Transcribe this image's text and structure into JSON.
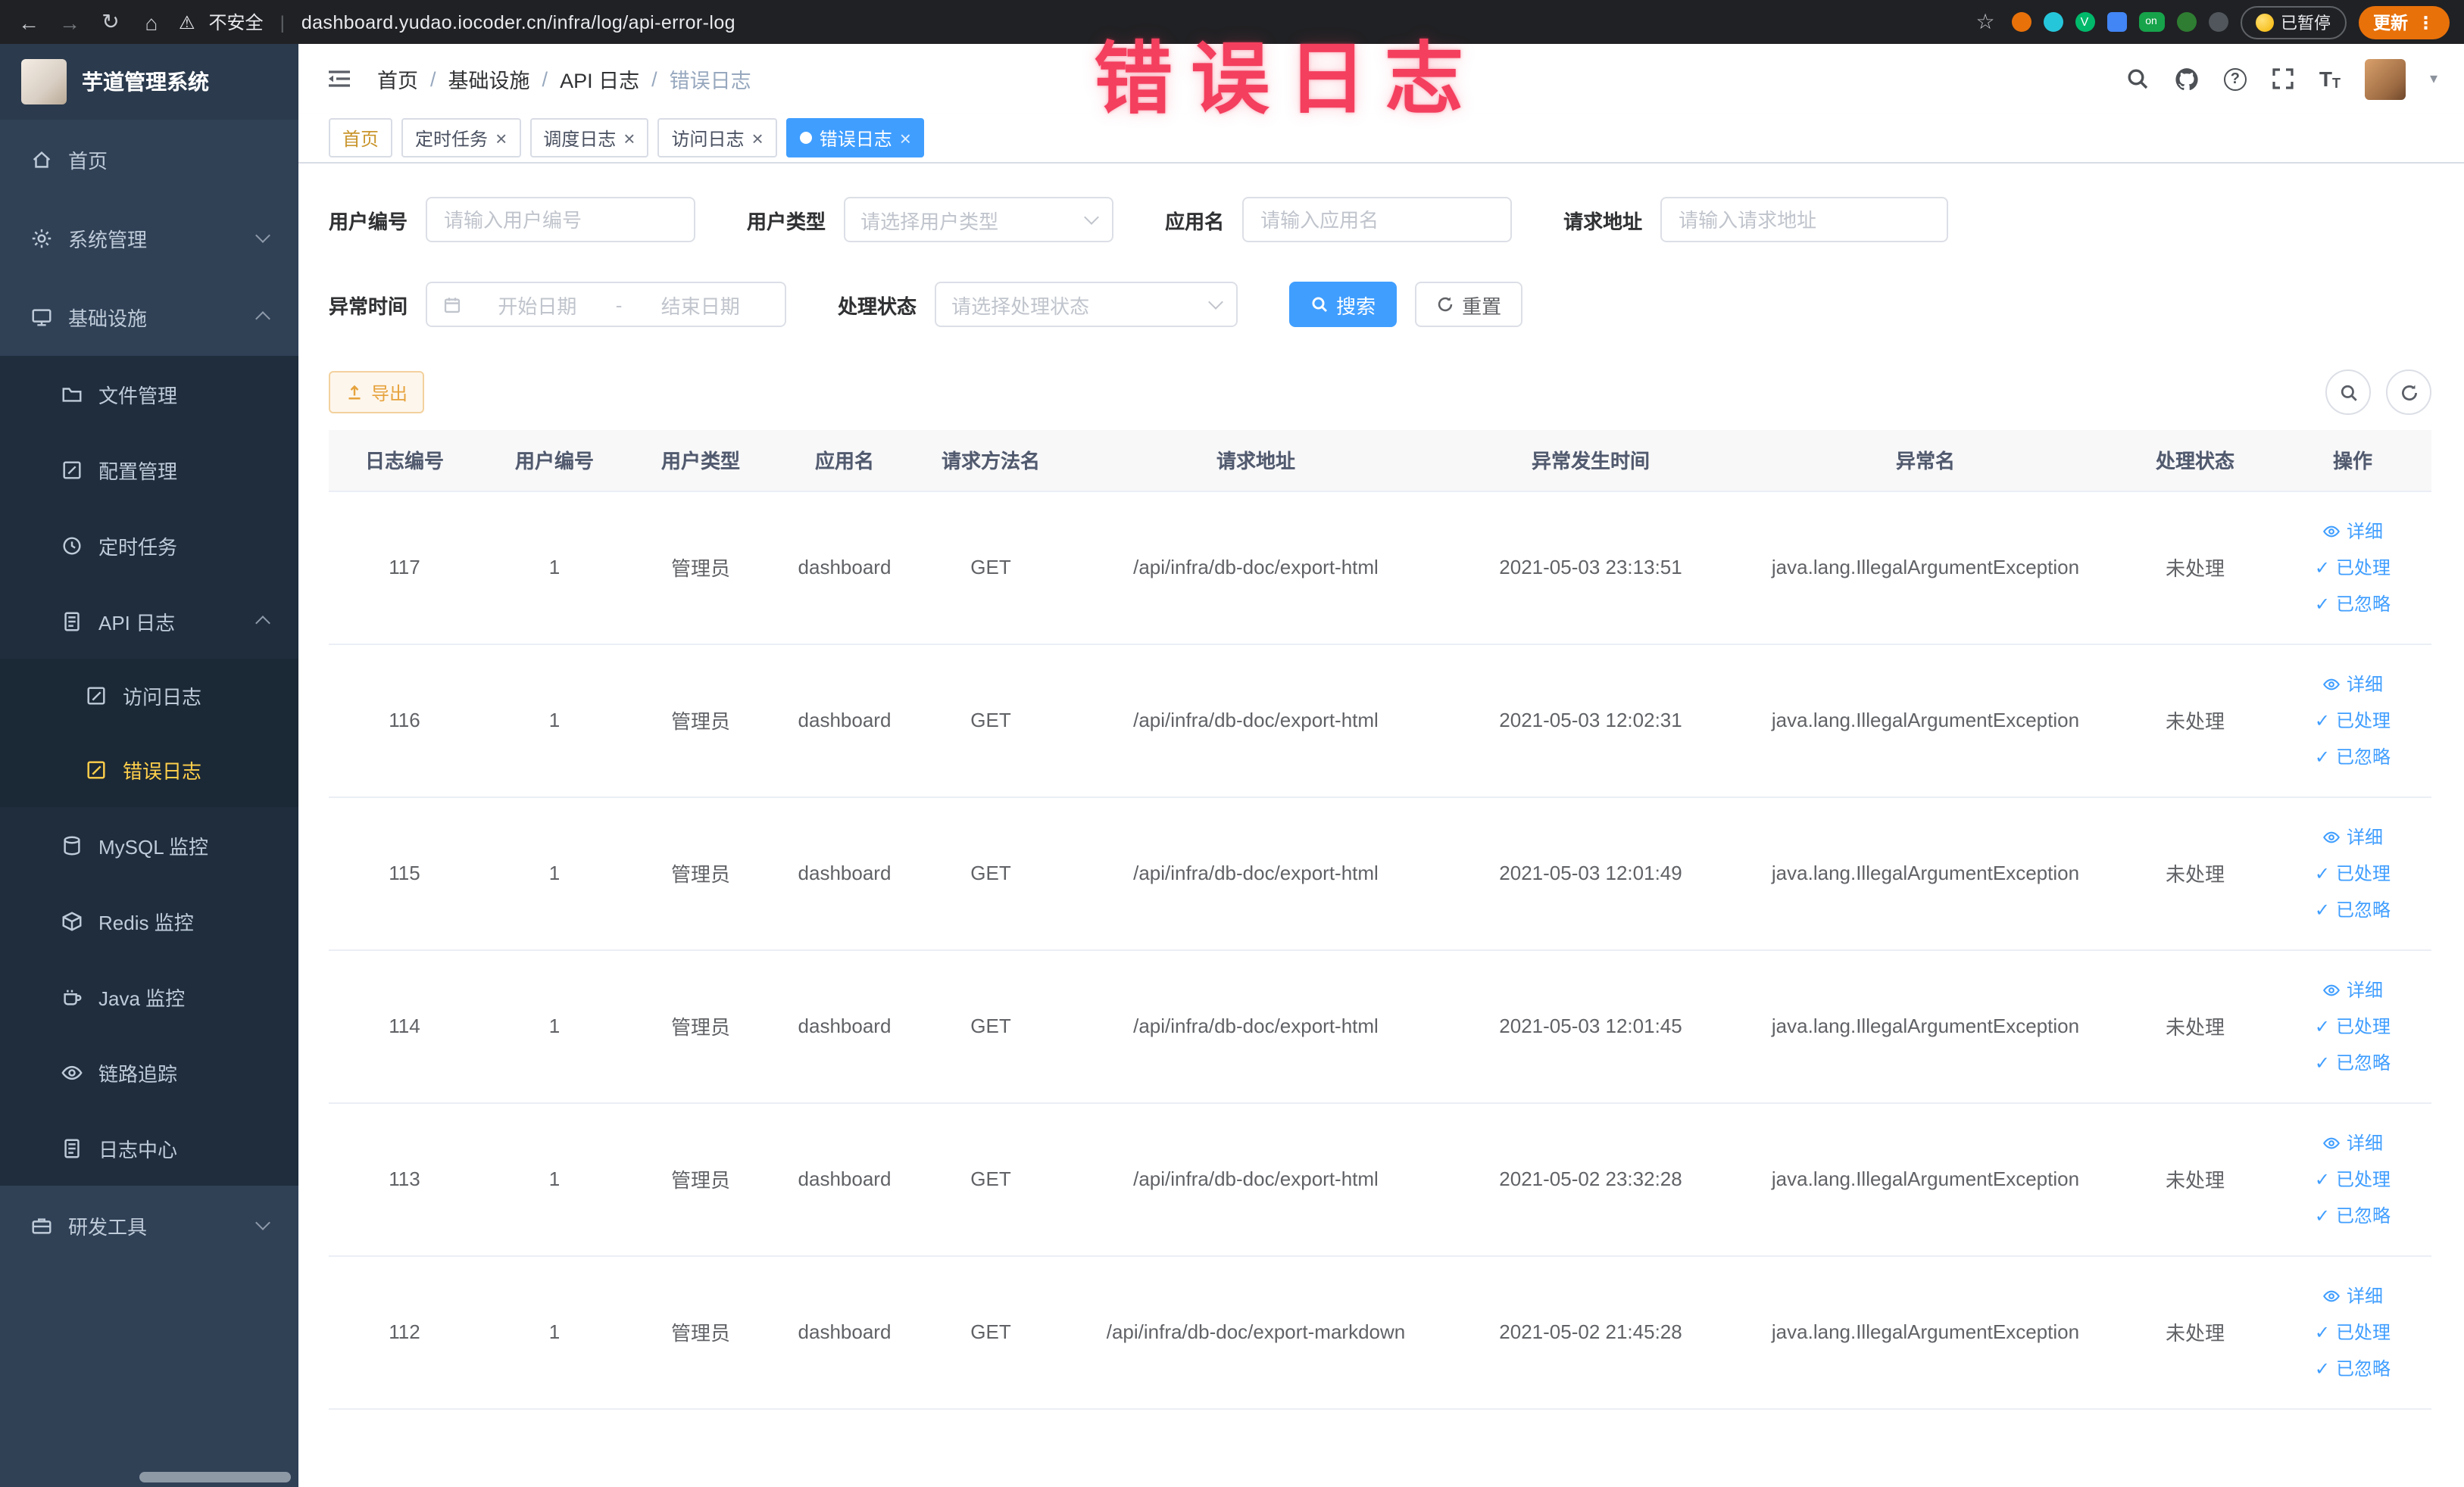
{
  "colors": {
    "accent": "#409eff",
    "sidebar_bg": "#304156",
    "sidebar_active": "#ffd04b",
    "warning": "#e6a23c",
    "annotation_pink": "#f43f5e",
    "tag_active_bg": "#409eff"
  },
  "icons": {
    "back": "←",
    "forward": "→",
    "reload": "↻",
    "home": "⌂",
    "warning": "⚠",
    "star": "☆",
    "more": "⋮",
    "divider": "|",
    "help": "?",
    "caret_down": "▾",
    "close": "×",
    "check": "✓",
    "font_size": "T",
    "ext_v": "V"
  },
  "annotation": {
    "text": "错误日志"
  },
  "browser": {
    "security_label": "不安全",
    "url": "dashboard.yudao.iocoder.cn/infra/log/api-error-log",
    "paused_label": "已暂停",
    "update_label": "更新",
    "extension_on_label": "on"
  },
  "sidebar": {
    "logo_title": "芋道管理系统",
    "items": [
      {
        "label": "首页"
      },
      {
        "label": "系统管理"
      },
      {
        "label": "基础设施"
      },
      {
        "label": "文件管理"
      },
      {
        "label": "配置管理"
      },
      {
        "label": "定时任务"
      },
      {
        "label": "API 日志"
      },
      {
        "label": "访问日志"
      },
      {
        "label": "错误日志"
      },
      {
        "label": "MySQL 监控"
      },
      {
        "label": "Redis 监控"
      },
      {
        "label": "Java 监控"
      },
      {
        "label": "链路追踪"
      },
      {
        "label": "日志中心"
      },
      {
        "label": "研发工具"
      }
    ]
  },
  "header": {
    "breadcrumb": [
      "首页",
      "基础设施",
      "API 日志",
      "错误日志"
    ],
    "breadcrumb_separator": "/"
  },
  "tabs": [
    {
      "label": "首页"
    },
    {
      "label": "定时任务"
    },
    {
      "label": "调度日志"
    },
    {
      "label": "访问日志"
    },
    {
      "label": "错误日志"
    }
  ],
  "filters": {
    "user_id": {
      "label": "用户编号",
      "placeholder": "请输入用户编号"
    },
    "user_type": {
      "label": "用户类型",
      "placeholder": "请选择用户类型"
    },
    "app_name": {
      "label": "应用名",
      "placeholder": "请输入应用名"
    },
    "request_url": {
      "label": "请求地址",
      "placeholder": "请输入请求地址"
    },
    "exception_time": {
      "label": "异常时间",
      "start_placeholder": "开始日期",
      "separator": "-",
      "end_placeholder": "结束日期"
    },
    "process_status": {
      "label": "处理状态",
      "placeholder": "请选择处理状态"
    },
    "search_label": "搜索",
    "reset_label": "重置"
  },
  "toolbar": {
    "export_label": "导出"
  },
  "table": {
    "columns": [
      "日志编号",
      "用户编号",
      "用户类型",
      "应用名",
      "请求方法名",
      "请求地址",
      "异常发生时间",
      "异常名",
      "处理状态",
      "操作"
    ],
    "actions": [
      "详细",
      "已处理",
      "已忽略"
    ],
    "rows": [
      {
        "id": "117",
        "user_id": "1",
        "user_type": "管理员",
        "app": "dashboard",
        "method": "GET",
        "url": "/api/infra/db-doc/export-html",
        "time": "2021-05-03 23:13:51",
        "exception": "java.lang.IllegalArgumentException",
        "status": "未处理"
      },
      {
        "id": "116",
        "user_id": "1",
        "user_type": "管理员",
        "app": "dashboard",
        "method": "GET",
        "url": "/api/infra/db-doc/export-html",
        "time": "2021-05-03 12:02:31",
        "exception": "java.lang.IllegalArgumentException",
        "status": "未处理"
      },
      {
        "id": "115",
        "user_id": "1",
        "user_type": "管理员",
        "app": "dashboard",
        "method": "GET",
        "url": "/api/infra/db-doc/export-html",
        "time": "2021-05-03 12:01:49",
        "exception": "java.lang.IllegalArgumentException",
        "status": "未处理"
      },
      {
        "id": "114",
        "user_id": "1",
        "user_type": "管理员",
        "app": "dashboard",
        "method": "GET",
        "url": "/api/infra/db-doc/export-html",
        "time": "2021-05-03 12:01:45",
        "exception": "java.lang.IllegalArgumentException",
        "status": "未处理"
      },
      {
        "id": "113",
        "user_id": "1",
        "user_type": "管理员",
        "app": "dashboard",
        "method": "GET",
        "url": "/api/infra/db-doc/export-html",
        "time": "2021-05-02 23:32:28",
        "exception": "java.lang.IllegalArgumentException",
        "status": "未处理"
      },
      {
        "id": "112",
        "user_id": "1",
        "user_type": "管理员",
        "app": "dashboard",
        "method": "GET",
        "url": "/api/infra/db-doc/export-markdown",
        "time": "2021-05-02 21:45:28",
        "exception": "java.lang.IllegalArgumentException",
        "status": "未处理"
      }
    ]
  }
}
